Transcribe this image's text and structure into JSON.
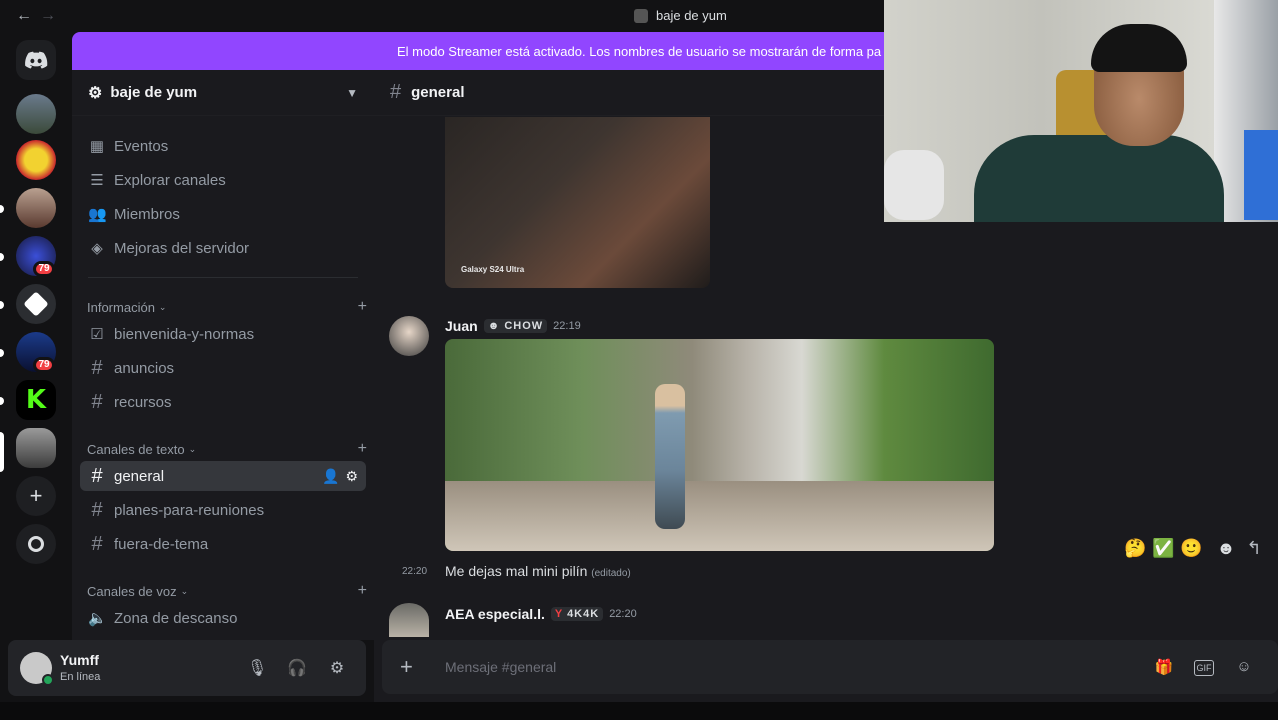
{
  "window": {
    "title": "baje de yum"
  },
  "streamer_banner": "El modo Streamer está activado. Los nombres de usuario se mostrarán de forma pa",
  "server": {
    "name": "baje de yum"
  },
  "sidebar": {
    "top_items": [
      {
        "label": "Eventos",
        "icon": "calendar-icon"
      },
      {
        "label": "Explorar canales",
        "icon": "browse-channels-icon"
      },
      {
        "label": "Miembros",
        "icon": "members-icon"
      },
      {
        "label": "Mejoras del servidor",
        "icon": "boost-icon"
      }
    ],
    "categories": [
      {
        "label": "Información",
        "channels": [
          "bienvenida-y-normas",
          "anuncios",
          "recursos"
        ]
      },
      {
        "label": "Canales de texto",
        "channels": [
          "general",
          "planes-para-reuniones",
          "fuera-de-tema"
        ]
      },
      {
        "label": "Canales de voz",
        "channels": [
          "Zona de descanso"
        ]
      }
    ]
  },
  "guild_badges": [
    "79",
    "79"
  ],
  "user": {
    "name": "Yumff",
    "status": "En línea"
  },
  "channel": {
    "name": "general"
  },
  "messages": [
    {
      "image_caption": "Galaxy S24 Ultra"
    },
    {
      "author": "Juan",
      "tag": "CHOW",
      "time": "22:19",
      "side_time": "22:20",
      "text": "Me dejas mal mini pilín",
      "edited": "(editado)"
    },
    {
      "author": "AEA especial.l.",
      "tag": "4K4K",
      "time": "22:20"
    }
  ],
  "composer": {
    "placeholder": "Mensaje #general"
  },
  "colors": {
    "accent": "#5865f2",
    "streamer_banner": "#9146ff",
    "online": "#23a55a",
    "badge": "#f23f43"
  }
}
